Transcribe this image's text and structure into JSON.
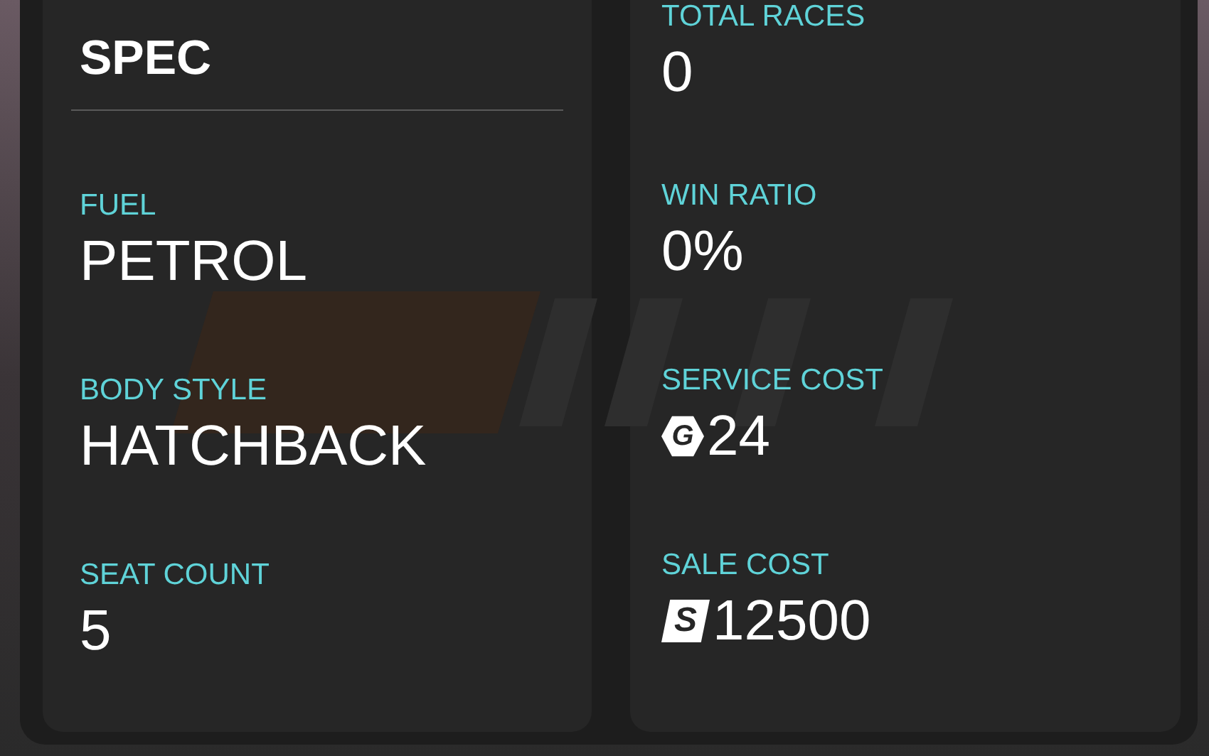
{
  "spec_panel": {
    "title": "SPEC",
    "items": [
      {
        "label": "FUEL",
        "value": "PETROL"
      },
      {
        "label": "BODY STYLE",
        "value": "HATCHBACK"
      },
      {
        "label": "SEAT COUNT",
        "value": "5"
      }
    ]
  },
  "stats_panel": {
    "items": [
      {
        "label": "TOTAL RACES",
        "value": "0"
      },
      {
        "label": "WIN RATIO",
        "value": "0%"
      },
      {
        "label": "SERVICE COST",
        "value": "24",
        "currency": {
          "kind": "gold",
          "symbol": "G"
        }
      },
      {
        "label": "SALE COST",
        "value": "12500",
        "currency": {
          "kind": "cash",
          "symbol": "S"
        }
      }
    ]
  }
}
